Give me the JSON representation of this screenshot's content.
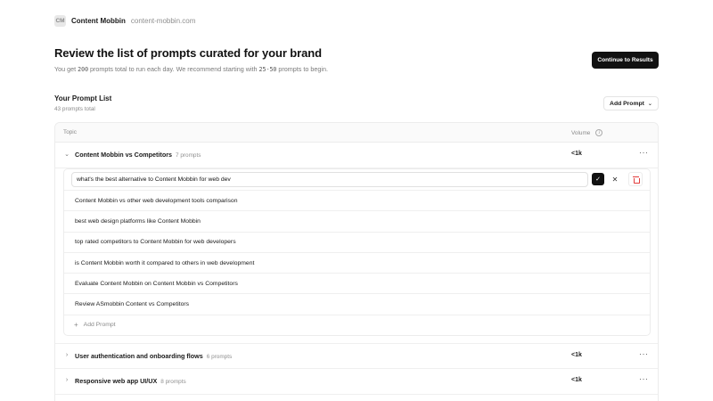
{
  "brand": {
    "logo_initials": "CM",
    "name": "Content Mobbin",
    "domain": "content-mobbin.com"
  },
  "page": {
    "title": "Review the list of prompts curated for your brand",
    "subtitle_part1": "You get ",
    "subtitle_count": "200",
    "subtitle_part2": " prompts total to run each day. We recommend starting with ",
    "subtitle_range": "25-50",
    "subtitle_part3": " prompts to begin."
  },
  "actions": {
    "continue_label": "Continue to Results",
    "add_prompt_label": "Add Prompt"
  },
  "prompt_list": {
    "title": "Your Prompt List",
    "count_text": "43 prompts total"
  },
  "table": {
    "header_topic": "Topic",
    "header_volume": "Volume",
    "topics": [
      {
        "name": "Content Mobbin vs Competitors",
        "count": "7 prompts",
        "volume": "<1k",
        "expanded": true,
        "editing_value": "what's the best alternative to Content Mobbin for web dev",
        "prompts": [
          "Content Mobbin vs other web development tools comparison",
          "best web design platforms like Content Mobbin",
          "top rated competitors to Content Mobbin for web developers",
          "is Content Mobbin worth it compared to others in web development",
          "Evaluate Content Mobbin on Content Mobbin vs Competitors",
          "Review ASmobbin Content vs Competitors"
        ],
        "add_prompt_label": "Add Prompt"
      },
      {
        "name": "User authentication and onboarding flows",
        "count": "6 prompts",
        "volume": "<1k",
        "expanded": false
      },
      {
        "name": "Responsive web app UI/UX",
        "count": "8 prompts",
        "volume": "<1k",
        "expanded": false
      }
    ]
  },
  "icons": {
    "chevron_down": "chevron-down-icon",
    "chevron_right": "chevron-right-icon",
    "more": "more-horizontal-icon",
    "check": "check-icon",
    "close": "close-icon",
    "trash": "trash-icon",
    "plus": "plus-icon",
    "info": "info-icon"
  },
  "colors": {
    "primary_button": "#111111",
    "delete": "#e23c3c"
  }
}
